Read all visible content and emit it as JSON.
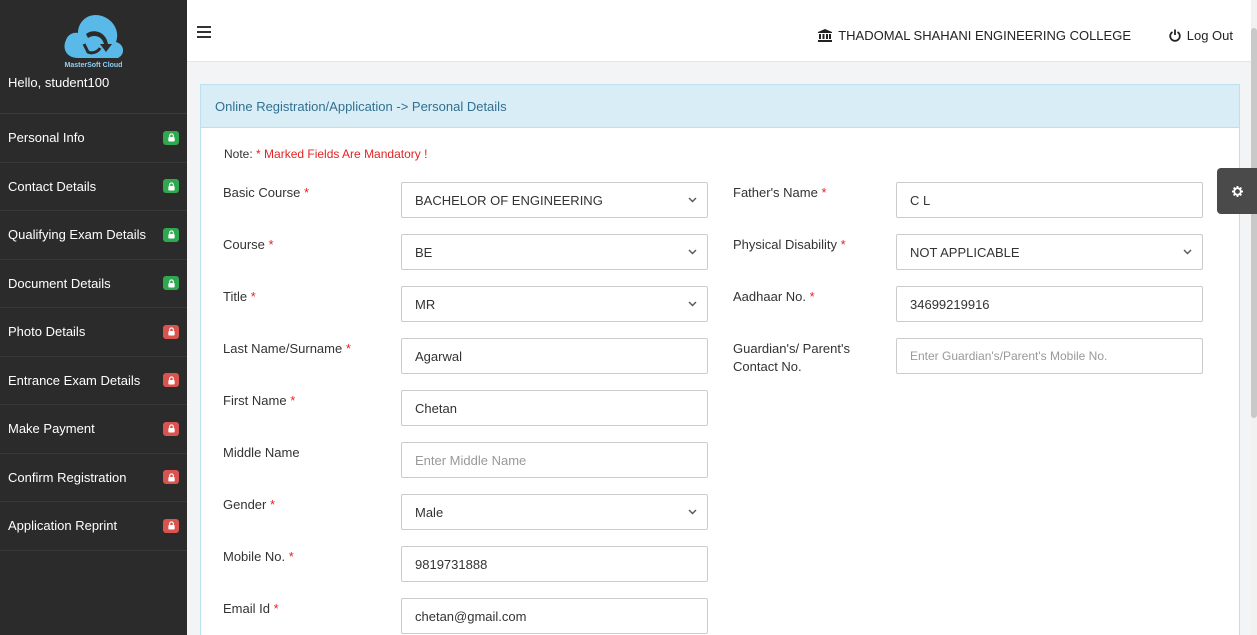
{
  "app": {
    "logo_text": "MasterSoft Cloud",
    "greeting": "Hello, student100",
    "college_name": "THADOMAL SHAHANI ENGINEERING COLLEGE",
    "logout_label": "Log Out"
  },
  "sidebar": {
    "items": [
      {
        "label": "Personal Info",
        "status": "green"
      },
      {
        "label": "Contact Details",
        "status": "green"
      },
      {
        "label": "Qualifying Exam Details",
        "status": "green"
      },
      {
        "label": "Document Details",
        "status": "green"
      },
      {
        "label": "Photo Details",
        "status": "red"
      },
      {
        "label": "Entrance Exam Details",
        "status": "red"
      },
      {
        "label": "Make Payment",
        "status": "red"
      },
      {
        "label": "Confirm Registration",
        "status": "red"
      },
      {
        "label": "Application Reprint",
        "status": "red"
      }
    ]
  },
  "panel": {
    "breadcrumb": "Online Registration/Application -> Personal Details",
    "note_prefix": "Note:",
    "note_text": " * Marked Fields Are Mandatory !"
  },
  "form": {
    "basic_course": {
      "label": "Basic Course",
      "value": "BACHELOR OF ENGINEERING"
    },
    "course": {
      "label": "Course",
      "value": "BE"
    },
    "title": {
      "label": "Title",
      "value": "MR"
    },
    "last_name": {
      "label": "Last Name/Surname",
      "value": "Agarwal"
    },
    "first_name": {
      "label": "First Name",
      "value": "Chetan"
    },
    "middle_name": {
      "label": "Middle Name",
      "placeholder": "Enter Middle Name"
    },
    "gender": {
      "label": "Gender",
      "value": "Male"
    },
    "mobile": {
      "label": "Mobile No.",
      "value": "9819731888"
    },
    "email": {
      "label": "Email Id",
      "value": "chetan@gmail.com"
    },
    "father_name": {
      "label": "Father's Name",
      "value": "C L"
    },
    "physical_disability": {
      "label": "Physical Disability",
      "value": "NOT APPLICABLE"
    },
    "aadhaar": {
      "label": "Aadhaar No.",
      "value": "34699219916"
    },
    "guardian_contact": {
      "label_line1": "Guardian's/ Parent's",
      "label_line2": "Contact No.",
      "placeholder": "Enter Guardian's/Parent's Mobile No."
    }
  },
  "colors": {
    "sidebar_bg": "#2b2b2b",
    "badge_done": "#2fa84f",
    "badge_pending": "#d9534f",
    "panel_header_bg": "#d9edf7",
    "required_star": "#e32424"
  },
  "icons": {
    "menu": "hamburger-icon",
    "college": "bank-icon",
    "logout": "power-icon",
    "settings": "gear-icon",
    "badge": "lock-icon"
  }
}
